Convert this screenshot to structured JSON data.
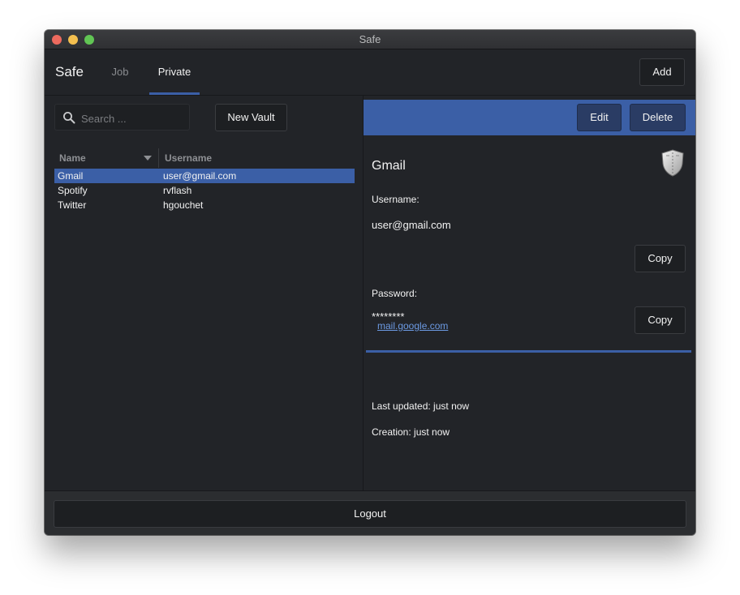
{
  "window": {
    "title": "Safe"
  },
  "header": {
    "brand": "Safe",
    "tabs": [
      {
        "label": "Job",
        "active": false
      },
      {
        "label": "Private",
        "active": true
      }
    ],
    "add_label": "Add"
  },
  "vault_list": {
    "search_placeholder": "Search ...",
    "new_vault_label": "New Vault",
    "columns": {
      "name": "Name",
      "username": "Username"
    },
    "rows": [
      {
        "name": "Gmail",
        "username": "user@gmail.com",
        "selected": true
      },
      {
        "name": "Spotify",
        "username": "rvflash",
        "selected": false
      },
      {
        "name": "Twitter",
        "username": "hgouchet",
        "selected": false
      }
    ]
  },
  "detail": {
    "edit_label": "Edit",
    "delete_label": "Delete",
    "title": "Gmail",
    "username_label": "Username:",
    "username_value": "user@gmail.com",
    "password_label": "Password:",
    "password_value": "********",
    "copy_label": "Copy",
    "link": "mail.google.com",
    "last_updated": "Last updated: just now",
    "creation": "Creation: just now"
  },
  "footer": {
    "logout_label": "Logout"
  },
  "colors": {
    "accent": "#3b5fa6",
    "background": "#222428",
    "link": "#6c9ae3"
  },
  "icons": {
    "search": "search-icon",
    "sort": "sort-descending-icon",
    "shield": "shield-icon"
  }
}
